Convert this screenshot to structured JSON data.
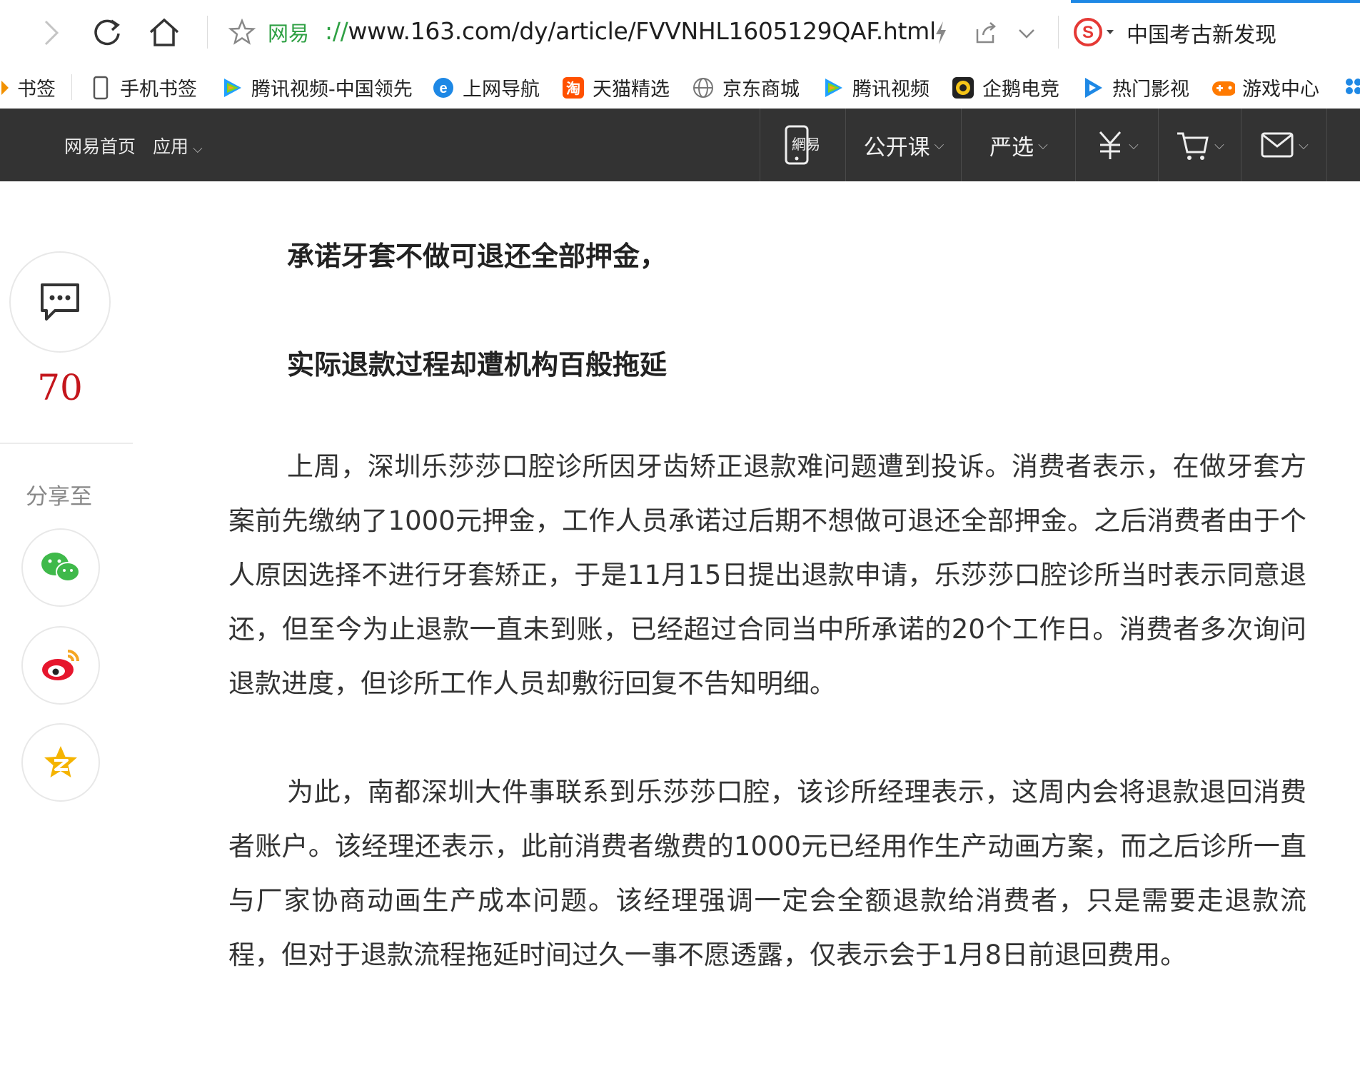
{
  "browser": {
    "site_tag": "网易",
    "url_protocol": "://",
    "url_rest": "www.163.com/dy/article/FVVNHL1605129QAF.html",
    "search_label": "中国考古新发现"
  },
  "bookmarks": [
    {
      "label": "书签",
      "icon": "bookmark-icon"
    },
    {
      "label": "手机书签",
      "icon": "phone-icon"
    },
    {
      "label": "腾讯视频-中国领先",
      "icon": "tencent-video-icon"
    },
    {
      "label": "上网导航",
      "icon": "ie-icon"
    },
    {
      "label": "天猫精选",
      "icon": "tmall-icon"
    },
    {
      "label": "京东商城",
      "icon": "globe-icon"
    },
    {
      "label": "腾讯视频",
      "icon": "tencent-video-icon"
    },
    {
      "label": "企鹅电竞",
      "icon": "penguin-esports-icon"
    },
    {
      "label": "热门影视",
      "icon": "play-icon"
    },
    {
      "label": "游戏中心",
      "icon": "gamepad-icon"
    }
  ],
  "sitenav": {
    "home": "网易首页",
    "apps": "应用",
    "app_badge": "網易",
    "course": "公开课",
    "yanxuan": "严选"
  },
  "rail": {
    "comment_count": "70",
    "share_label": "分享至"
  },
  "article": {
    "headline1": "承诺牙套不做可退还全部押金，",
    "headline2": "实际退款过程却遭机构百般拖延",
    "para1": "上周，深圳乐莎莎口腔诊所因牙齿矫正退款难问题遭到投诉。消费者表示，在做牙套方案前先缴纳了1000元押金，工作人员承诺过后期不想做可退还全部押金。之后消费者由于个人原因选择不进行牙套矫正，于是11月15日提出退款申请，乐莎莎口腔诊所当时表示同意退还，但至今为止退款一直未到账，已经超过合同当中所承诺的20个工作日。消费者多次询问退款进度，但诊所工作人员却敷衍回复不告知明细。",
    "para2": "为此，南都深圳大件事联系到乐莎莎口腔，该诊所经理表示，这周内会将退款退回消费者账户。该经理还表示，此前消费者缴费的1000元已经用作生产动画方案，而之后诊所一直与厂家协商动画生产成本问题。该经理强调一定会全额退款给消费者，只是需要走退款流程，但对于退款流程拖延时间过久一事不愿透露，仅表示会于1月8日前退回费用。"
  },
  "colors": {
    "nav_bg": "#333333",
    "count_red": "#c4161c",
    "green": "#2ea043",
    "wechat": "#3fb94a",
    "weibo": "#e6162d",
    "qzone": "#f5b400"
  }
}
